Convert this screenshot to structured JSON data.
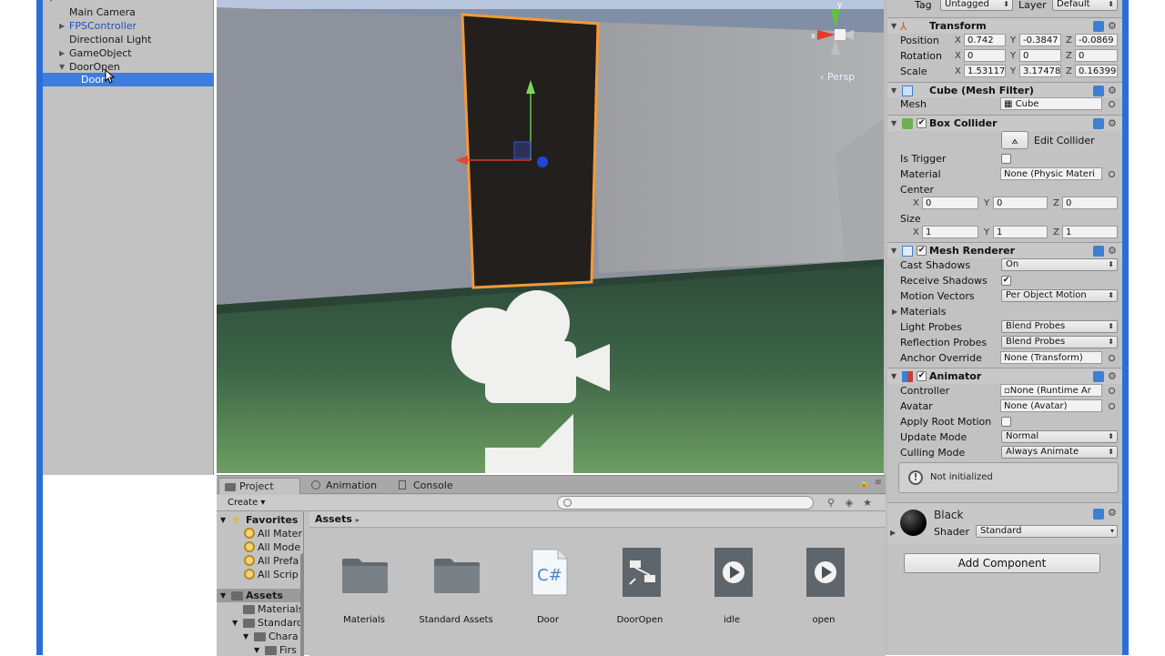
{
  "hierarchy": {
    "items": [
      {
        "label": "Main Camera"
      },
      {
        "label": "FPSController"
      },
      {
        "label": "Directional Light"
      },
      {
        "label": "GameObject"
      },
      {
        "label": "DoorOpen"
      },
      {
        "label": "Door"
      }
    ]
  },
  "scene": {
    "persp_label": "Persp",
    "gizmo_x": "x",
    "gizmo_y": "y"
  },
  "project": {
    "tabs": [
      {
        "label": "Project"
      },
      {
        "label": "Animation"
      },
      {
        "label": "Console"
      }
    ],
    "create_label": "Create",
    "favorites": {
      "title": "Favorites",
      "items": [
        "All Mater",
        "All Mode",
        "All Prefa",
        "All Scrip"
      ]
    },
    "tree": {
      "assets": "Assets",
      "items": [
        "Materials",
        "Standard",
        "Chara",
        "Firs"
      ]
    },
    "path": "Assets",
    "assets": [
      {
        "label": "Materials",
        "kind": "folder"
      },
      {
        "label": "Standard Assets",
        "kind": "folder"
      },
      {
        "label": "Door",
        "kind": "csharp"
      },
      {
        "label": "DoorOpen",
        "kind": "controller"
      },
      {
        "label": "idle",
        "kind": "animation"
      },
      {
        "label": "open",
        "kind": "animation"
      }
    ]
  },
  "inspector": {
    "tag_label": "Tag",
    "tag_value": "Untagged",
    "layer_label": "Layer",
    "layer_value": "Default",
    "transform": {
      "title": "Transform",
      "position_label": "Position",
      "rotation_label": "Rotation",
      "scale_label": "Scale",
      "position": {
        "x": "0.742",
        "y": "-0.3847",
        "z": "-0.0869"
      },
      "rotation": {
        "x": "0",
        "y": "0",
        "z": "0"
      },
      "scale": {
        "x": "1.53117",
        "y": "3.17478",
        "z": "0.16399"
      }
    },
    "mesh_filter": {
      "title": "Cube (Mesh Filter)",
      "mesh_label": "Mesh",
      "mesh_value": "Cube"
    },
    "box_collider": {
      "title": "Box Collider",
      "edit_label": "Edit Collider",
      "is_trigger_label": "Is Trigger",
      "material_label": "Material",
      "material_value": "None (Physic Materi",
      "center_label": "Center",
      "center": {
        "x": "0",
        "y": "0",
        "z": "0"
      },
      "size_label": "Size",
      "size": {
        "x": "1",
        "y": "1",
        "z": "1"
      }
    },
    "mesh_renderer": {
      "title": "Mesh Renderer",
      "cast_shadows_label": "Cast Shadows",
      "cast_shadows_value": "On",
      "receive_shadows_label": "Receive Shadows",
      "motion_vectors_label": "Motion Vectors",
      "motion_vectors_value": "Per Object Motion",
      "materials_label": "Materials",
      "light_probes_label": "Light Probes",
      "light_probes_value": "Blend Probes",
      "reflection_probes_label": "Reflection Probes",
      "reflection_probes_value": "Blend Probes",
      "anchor_override_label": "Anchor Override",
      "anchor_override_value": "None (Transform)"
    },
    "animator": {
      "title": "Animator",
      "controller_label": "Controller",
      "controller_value": "None (Runtime Ar",
      "avatar_label": "Avatar",
      "avatar_value": "None (Avatar)",
      "apply_root_motion_label": "Apply Root Motion",
      "update_mode_label": "Update Mode",
      "update_mode_value": "Normal",
      "culling_mode_label": "Culling Mode",
      "culling_mode_value": "Always Animate",
      "info_text": "Not initialized"
    },
    "material": {
      "name": "Black",
      "shader_label": "Shader",
      "shader_value": "Standard"
    },
    "add_component_label": "Add Component"
  }
}
